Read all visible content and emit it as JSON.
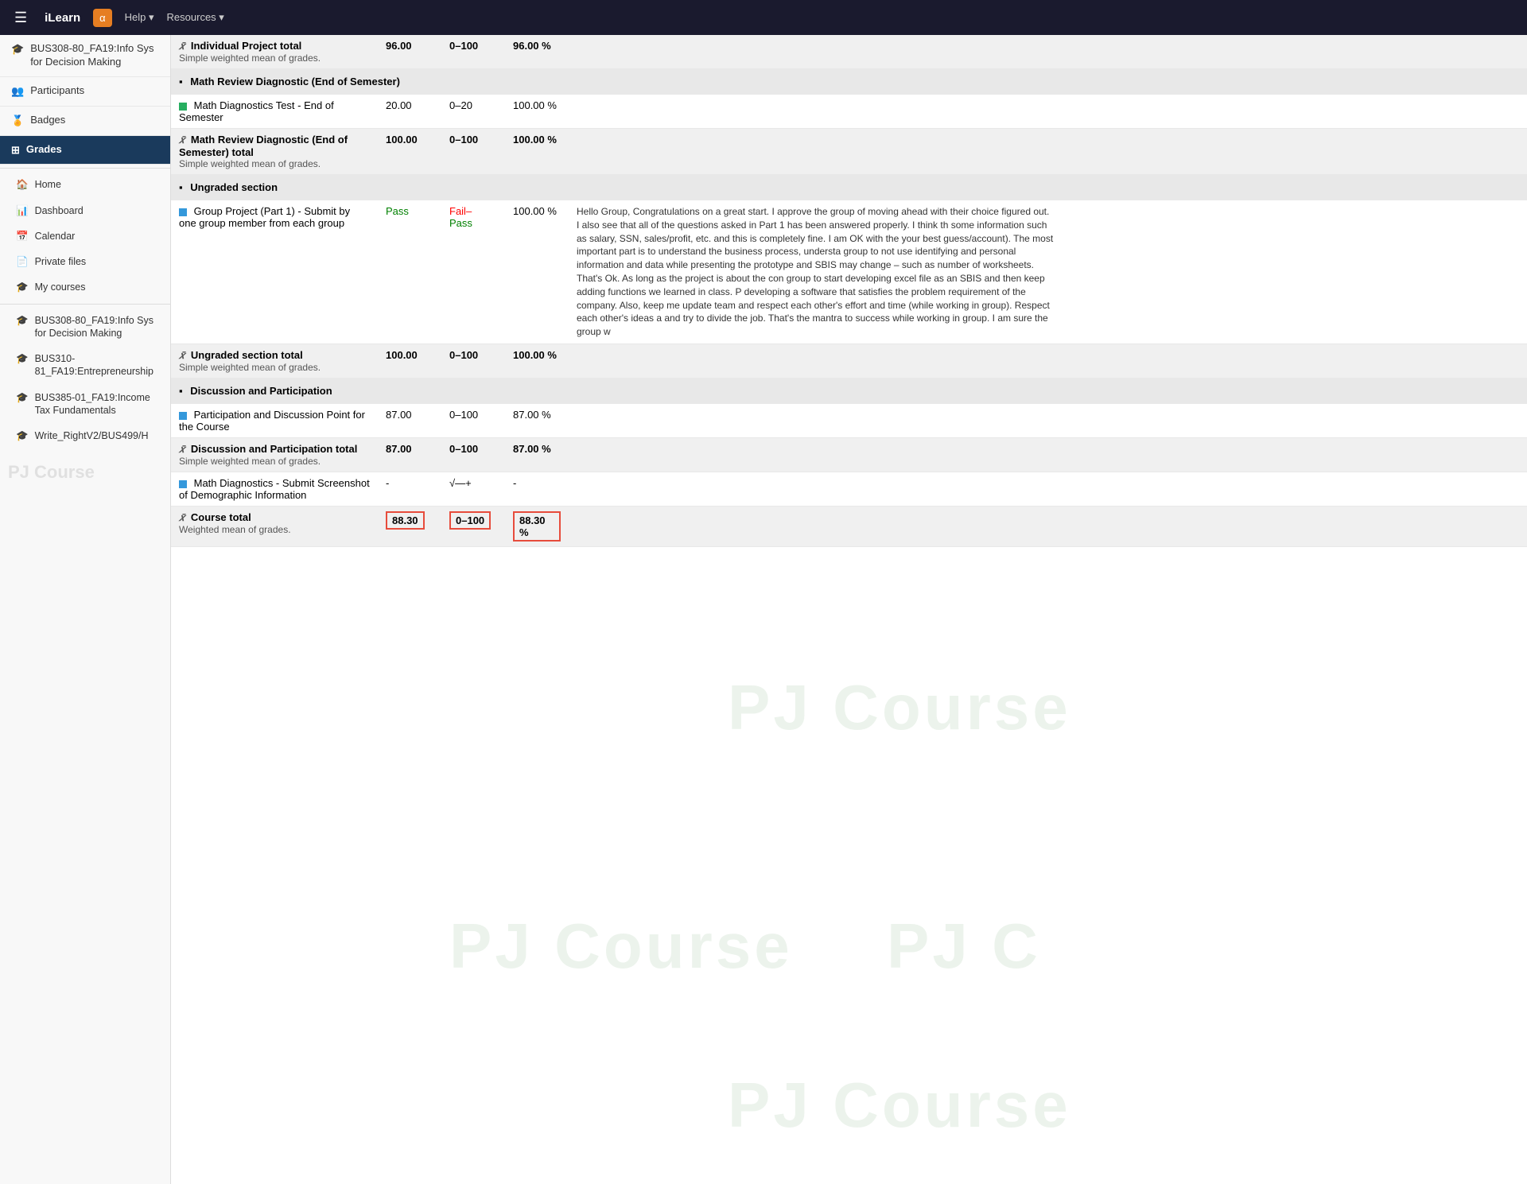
{
  "topNav": {
    "hamburger": "☰",
    "brand": "iLearn",
    "navIcon": "α",
    "links": [
      "Help ▾",
      "Resources ▾"
    ]
  },
  "sidebar": {
    "courseTitle": "BUS308-80_FA19:Info Sys for Decision Making",
    "items": [
      {
        "id": "participants",
        "icon": "👥",
        "label": "Participants"
      },
      {
        "id": "badges",
        "icon": "🏅",
        "label": "Badges"
      },
      {
        "id": "grades",
        "icon": "⊞",
        "label": "Grades",
        "active": true
      },
      {
        "id": "home",
        "icon": "🏠",
        "label": "Home",
        "sub": true
      },
      {
        "id": "dashboard",
        "icon": "📊",
        "label": "Dashboard",
        "sub": true
      },
      {
        "id": "calendar",
        "icon": "📅",
        "label": "Calendar",
        "sub": true
      },
      {
        "id": "private-files",
        "icon": "📄",
        "label": "Private files",
        "sub": true
      },
      {
        "id": "my-courses",
        "icon": "🎓",
        "label": "My courses",
        "sub": true
      }
    ],
    "courses": [
      {
        "label": "BUS308-80_FA19:Info Sys for Decision Making"
      },
      {
        "label": "BUS310-81_FA19:Entrepreneurship"
      },
      {
        "label": "BUS385-01_FA19:Income Tax Fundamentals"
      },
      {
        "label": "Write_RightV2/BUS499/H"
      }
    ]
  },
  "grades": {
    "watermarks": [
      "PJ Course",
      "PJ Course",
      "PJ Course",
      "PJ Course"
    ],
    "sections": [
      {
        "type": "item",
        "name": "Individual Project total",
        "grade": "96.00",
        "range": "0–100",
        "percent": "96.00 %",
        "feedback": "",
        "subtext": "Simple weighted mean of grades.",
        "iconType": "agg",
        "isTotal": true
      }
    ],
    "mathReviewSection": {
      "header": "Math Review Diagnostic (End of Semester)",
      "items": [
        {
          "name": "Math Diagnostics Test - End of Semester",
          "grade": "20.00",
          "range": "0–20",
          "percent": "100.00 %",
          "feedback": "",
          "iconType": "sq-green"
        }
      ],
      "total": {
        "name": "Math Review Diagnostic (End of Semester) total",
        "grade": "100.00",
        "range": "0–100",
        "percent": "100.00 %",
        "subtext": "Simple weighted mean of grades.",
        "iconType": "agg"
      }
    },
    "ungradedSection": {
      "header": "Ungraded section",
      "items": [
        {
          "name": "Group Project (Part 1) - Submit by one group member from each group",
          "grade": "Pass",
          "range": "Fail–Pass",
          "percent": "100.00 %",
          "feedback": "Hello Group, Congratulations on a great start. I approve the group of moving ahead with their choice figured out. I also see that all of the questions asked in Part 1 has been answered properly. I think th some information such as salary, SSN, sales/profit, etc. and this is completely fine. I am OK with the your best guess/account). The most important part is to understand the business process, understa group to not use identifying and personal information and data while presenting the prototype and SBIS may change – such as number of worksheets. That's Ok. As long as the project is about the con group to start developing excel file as an SBIS and then keep adding functions we learned in class. P developing a software that satisfies the problem requirement of the company. Also, keep me update team and respect each other's effort and time (while working in group). Respect each other's ideas a and try to divide the job. That's the mantra to success while working in group. I am sure the group w",
          "iconType": "sq-blue"
        }
      ],
      "total": {
        "name": "Ungraded section total",
        "grade": "100.00",
        "range": "0–100",
        "percent": "100.00 %",
        "subtext": "Simple weighted mean of grades.",
        "iconType": "agg"
      }
    },
    "discussionSection": {
      "header": "Discussion and Participation",
      "items": [
        {
          "name": "Participation and Discussion Point for the Course",
          "grade": "87.00",
          "range": "0–100",
          "percent": "87.00 %",
          "feedback": "",
          "iconType": "sq-blue"
        }
      ],
      "total": {
        "name": "Discussion and Participation total",
        "grade": "87.00",
        "range": "0–100",
        "percent": "87.00 %",
        "subtext": "Simple weighted mean of grades.",
        "iconType": "agg"
      },
      "extraItem": {
        "name": "Math Diagnostics - Submit Screenshot of Demographic Information",
        "grade": "-",
        "range": "√—+",
        "percent": "-",
        "feedback": "",
        "iconType": "sq-blue"
      }
    },
    "courseTotal": {
      "name": "Course total",
      "grade": "88.30",
      "range": "0–100",
      "percent": "88.30 %",
      "subtext": "Weighted mean of grades.",
      "iconType": "agg",
      "highlighted": true
    }
  }
}
